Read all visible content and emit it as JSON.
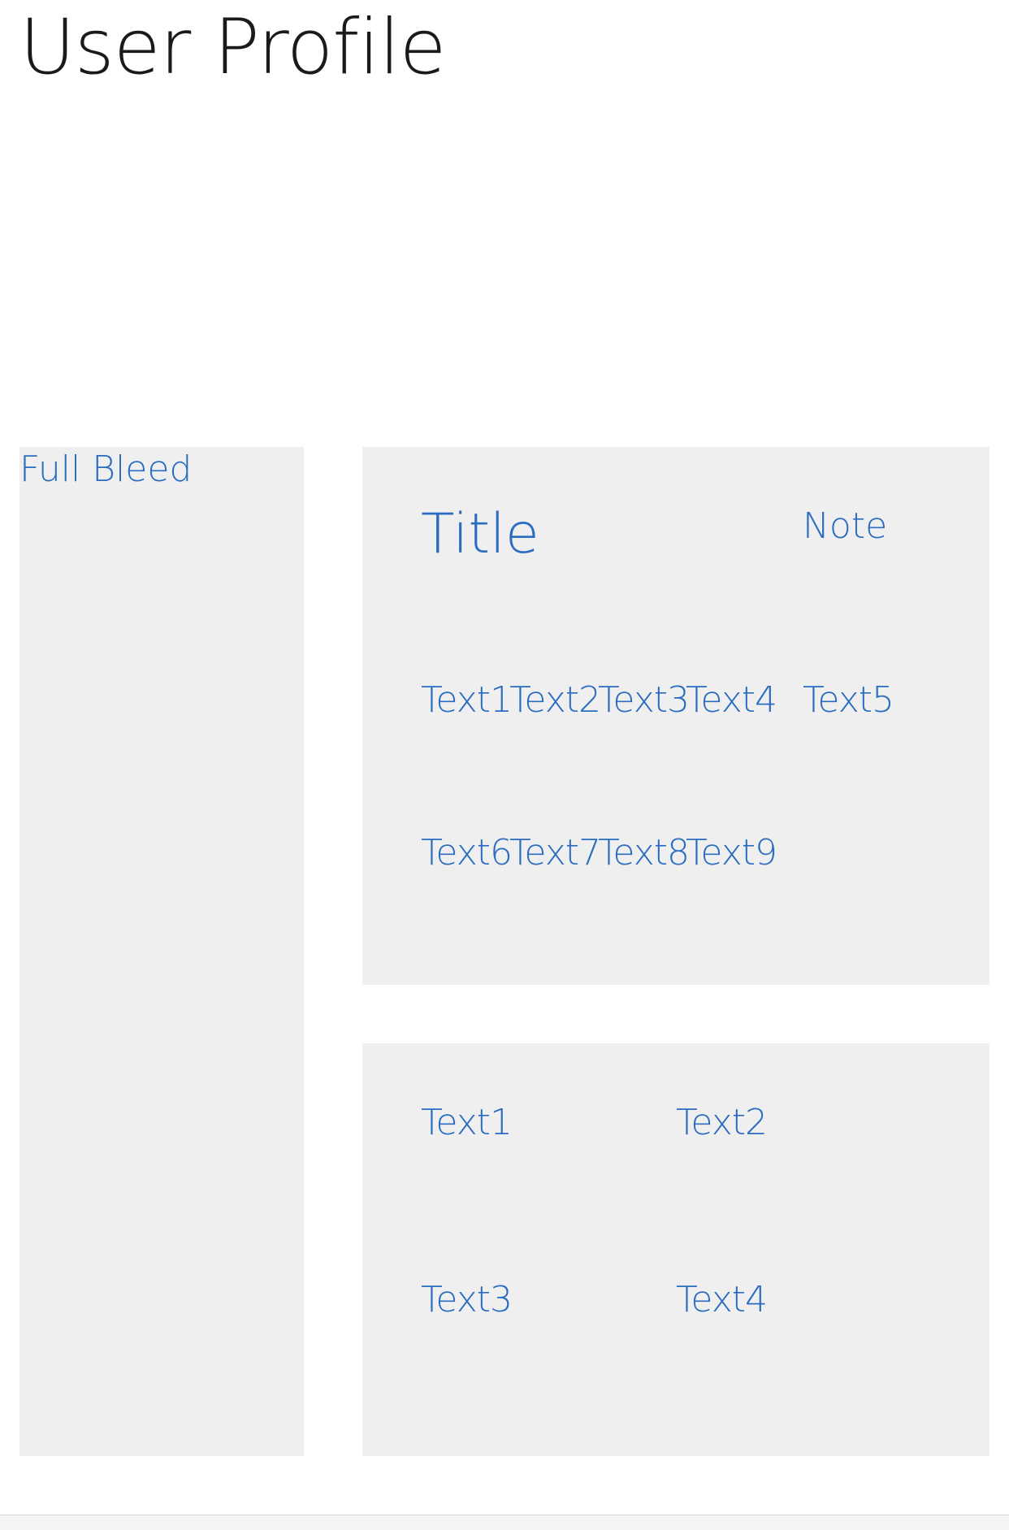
{
  "page": {
    "title": "User Profile"
  },
  "left_panel": {
    "label": "Full Bleed"
  },
  "card_top": {
    "title": "Title",
    "note": "Note",
    "row1": [
      "Text1",
      "Text2",
      "Text3",
      "Text4",
      "Text5"
    ],
    "row2": [
      "Text6",
      "Text7",
      "Text8",
      "Text9"
    ]
  },
  "card_bottom": {
    "items": [
      "Text1",
      "Text2",
      "Text3",
      "Text4"
    ]
  },
  "colors": {
    "accent_text": "#2a6cc0",
    "panel_background": "#efefef",
    "title_text": "#1a1a1a"
  }
}
